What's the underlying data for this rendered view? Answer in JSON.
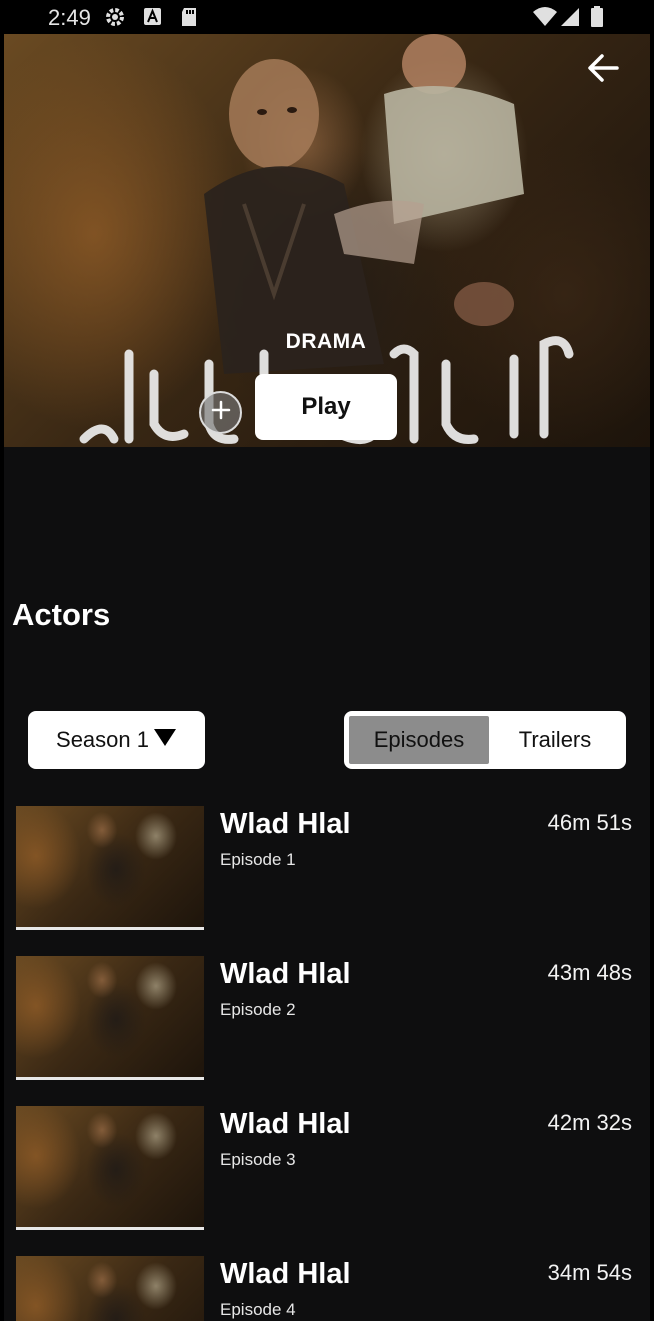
{
  "status_bar": {
    "time": "2:49"
  },
  "hero": {
    "genre": "DRAMA",
    "play_label": "Play",
    "add_symbol": "+"
  },
  "actors": {
    "heading": "Actors"
  },
  "season_select": {
    "label": "Season 1"
  },
  "tabs": [
    {
      "label": "Episodes",
      "active": true
    },
    {
      "label": "Trailers",
      "active": false
    }
  ],
  "episodes": [
    {
      "title": "Wlad Hlal",
      "number": "Episode 1",
      "duration": "46m 51s"
    },
    {
      "title": "Wlad Hlal",
      "number": "Episode 2",
      "duration": "43m 48s"
    },
    {
      "title": "Wlad Hlal",
      "number": "Episode 3",
      "duration": "42m 32s"
    },
    {
      "title": "Wlad Hlal",
      "number": "Episode 4",
      "duration": "34m 54s"
    }
  ],
  "icons": {
    "status_left": [
      "gear-icon",
      "a-notification-icon",
      "sd-card-icon"
    ],
    "status_right": [
      "wifi-icon",
      "signal-icon",
      "battery-icon"
    ],
    "back": "arrow-left-icon",
    "dropdown": "triangle-down-icon"
  },
  "colors": {
    "background": "#0e0e0f",
    "active_tab": "#8c8c8c",
    "button_bg": "#ffffff"
  }
}
